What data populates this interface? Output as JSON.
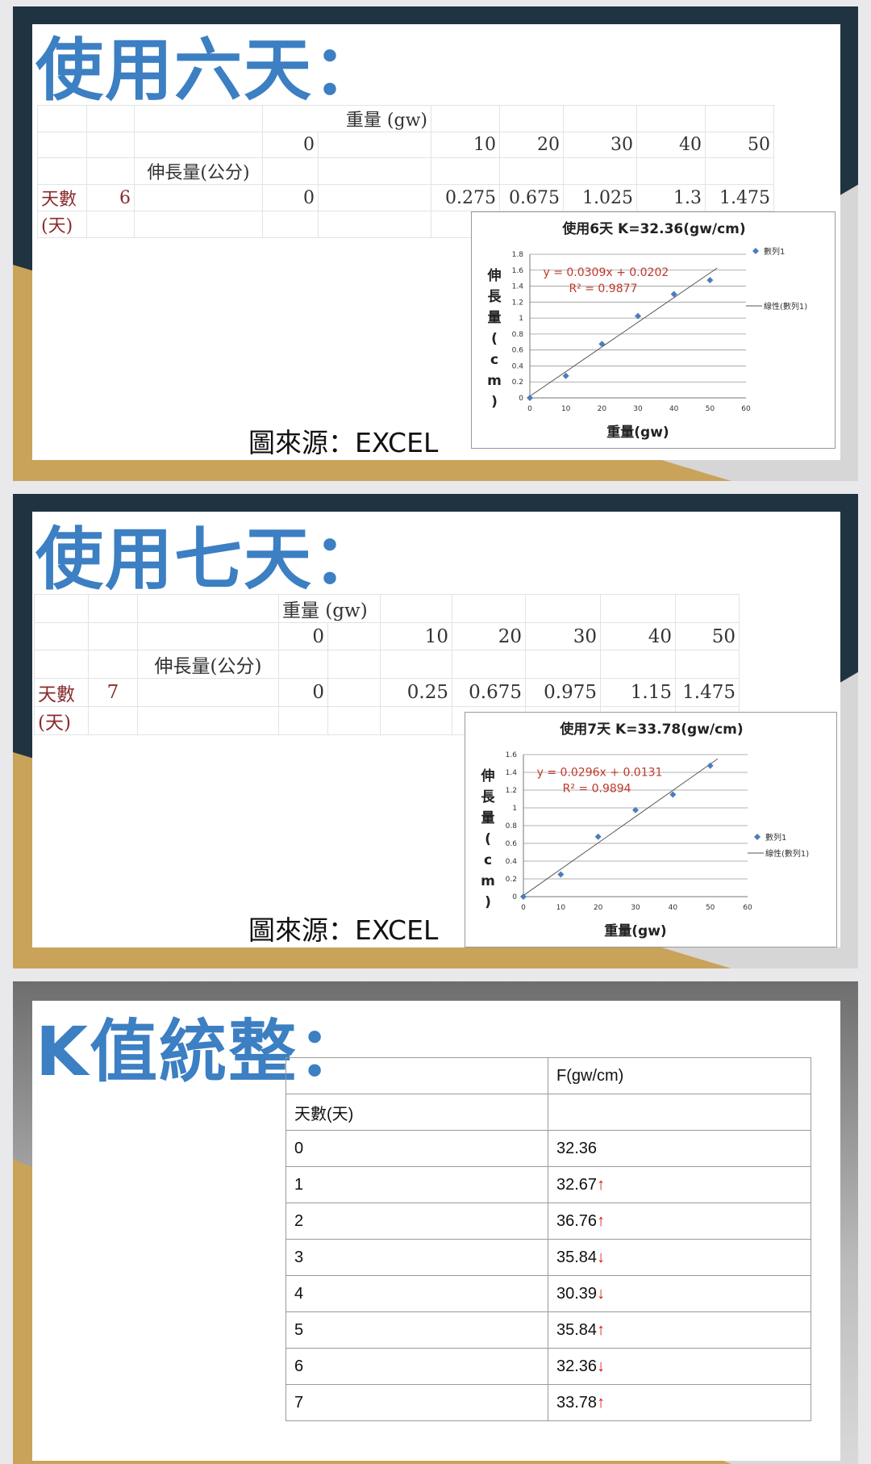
{
  "slide1": {
    "title": "使用六天：",
    "table": {
      "header_weight": "重量 (gw)",
      "header_length": "伸長量(公分)",
      "weights": [
        "0",
        "10",
        "20",
        "30",
        "40",
        "50"
      ],
      "row_label": "天數",
      "row_label2": "(天)",
      "day": "6",
      "values": [
        "0",
        "0.275",
        "0.675",
        "1.025",
        "1.3",
        "1.475"
      ]
    },
    "source": "圖來源：EXCEL",
    "chart_data": {
      "type": "scatter",
      "title": "使用6天 K=32.36(gw/cm)",
      "xlabel": "重量(gw)",
      "ylabel": "伸長量(cm)",
      "ylabel_chars": [
        "伸",
        "長",
        "量",
        "(",
        "c",
        "m",
        ")"
      ],
      "x": [
        0,
        10,
        20,
        30,
        40,
        50
      ],
      "series": [
        {
          "name": "數列1",
          "values": [
            0,
            0.275,
            0.675,
            1.025,
            1.3,
            1.475
          ]
        }
      ],
      "trendline_name": "線性(數列1)",
      "equation": "y = 0.0309x + 0.0202",
      "r2": "R² = 0.9877",
      "slope": 0.0309,
      "intercept": 0.0202,
      "xlim": [
        0,
        60
      ],
      "ylim": [
        0,
        1.8
      ],
      "xticks": [
        0,
        10,
        20,
        30,
        40,
        50,
        60
      ],
      "yticks": [
        0,
        0.2,
        0.4,
        0.6,
        0.8,
        1,
        1.2,
        1.4,
        1.6,
        1.8
      ],
      "legend_position": "right",
      "grid": true,
      "point_color": "#4a7ebb",
      "equation_color": "#c0392b"
    }
  },
  "slide2": {
    "title": "使用七天：",
    "table": {
      "header_weight": "重量 (gw)",
      "header_length": "伸長量(公分)",
      "weights": [
        "0",
        "10",
        "20",
        "30",
        "40",
        "50"
      ],
      "row_label": "天數",
      "row_label2": "(天)",
      "day": "7",
      "values": [
        "0",
        "0.25",
        "0.675",
        "0.975",
        "1.15",
        "1.475"
      ]
    },
    "source": "圖來源：EXCEL",
    "chart_data": {
      "type": "scatter",
      "title": "使用7天 K=33.78(gw/cm)",
      "xlabel": "重量(gw)",
      "ylabel": "伸長量(cm)",
      "ylabel_chars": [
        "伸",
        "長",
        "量",
        "(",
        "c",
        "m",
        ")"
      ],
      "x": [
        0,
        10,
        20,
        30,
        40,
        50
      ],
      "series": [
        {
          "name": "數列1",
          "values": [
            0,
            0.25,
            0.675,
            0.975,
            1.15,
            1.475
          ]
        }
      ],
      "trendline_name": "線性(數列1)",
      "equation": "y = 0.0296x + 0.0131",
      "r2": "R² = 0.9894",
      "slope": 0.0296,
      "intercept": 0.0131,
      "xlim": [
        0,
        60
      ],
      "ylim": [
        0,
        1.6
      ],
      "xticks": [
        0,
        10,
        20,
        30,
        40,
        50,
        60
      ],
      "yticks": [
        0,
        0.2,
        0.4,
        0.6,
        0.8,
        1,
        1.2,
        1.4,
        1.6
      ],
      "legend_position": "right",
      "grid": true,
      "point_color": "#4a7ebb",
      "equation_color": "#c0392b"
    }
  },
  "slide3": {
    "title": "K值統整：",
    "table": {
      "col_header": "F(gw/cm)",
      "row_header": "天數(天)",
      "rows": [
        {
          "day": "0",
          "k": "32.36",
          "arrow": ""
        },
        {
          "day": "1",
          "k": "32.67",
          "arrow": "↑"
        },
        {
          "day": "2",
          "k": "36.76",
          "arrow": "↑"
        },
        {
          "day": "3",
          "k": "35.84",
          "arrow": "↓"
        },
        {
          "day": "4",
          "k": "30.39",
          "arrow": "↓"
        },
        {
          "day": "5",
          "k": "35.84",
          "arrow": "↑"
        },
        {
          "day": "6",
          "k": "32.36",
          "arrow": "↓"
        },
        {
          "day": "7",
          "k": "33.78",
          "arrow": "↑"
        }
      ]
    }
  }
}
